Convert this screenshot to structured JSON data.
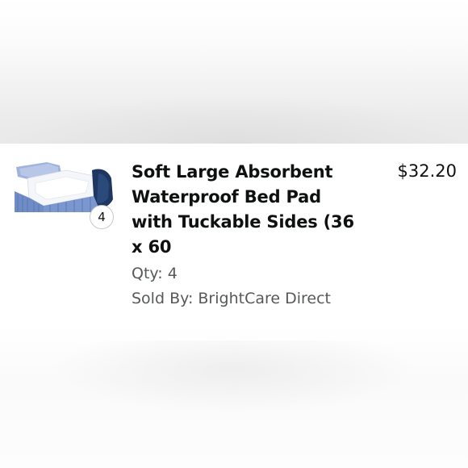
{
  "order_item": {
    "title": "Soft Large Absorbent Waterproof Bed Pad with Tuckable Sides (36 x 60",
    "price": "$32.20",
    "quantity_badge": "4",
    "quantity_text": "Qty: 4",
    "seller_text": "Sold By: BrightCare Direct",
    "image_icon": "bed-pad-product-image"
  }
}
